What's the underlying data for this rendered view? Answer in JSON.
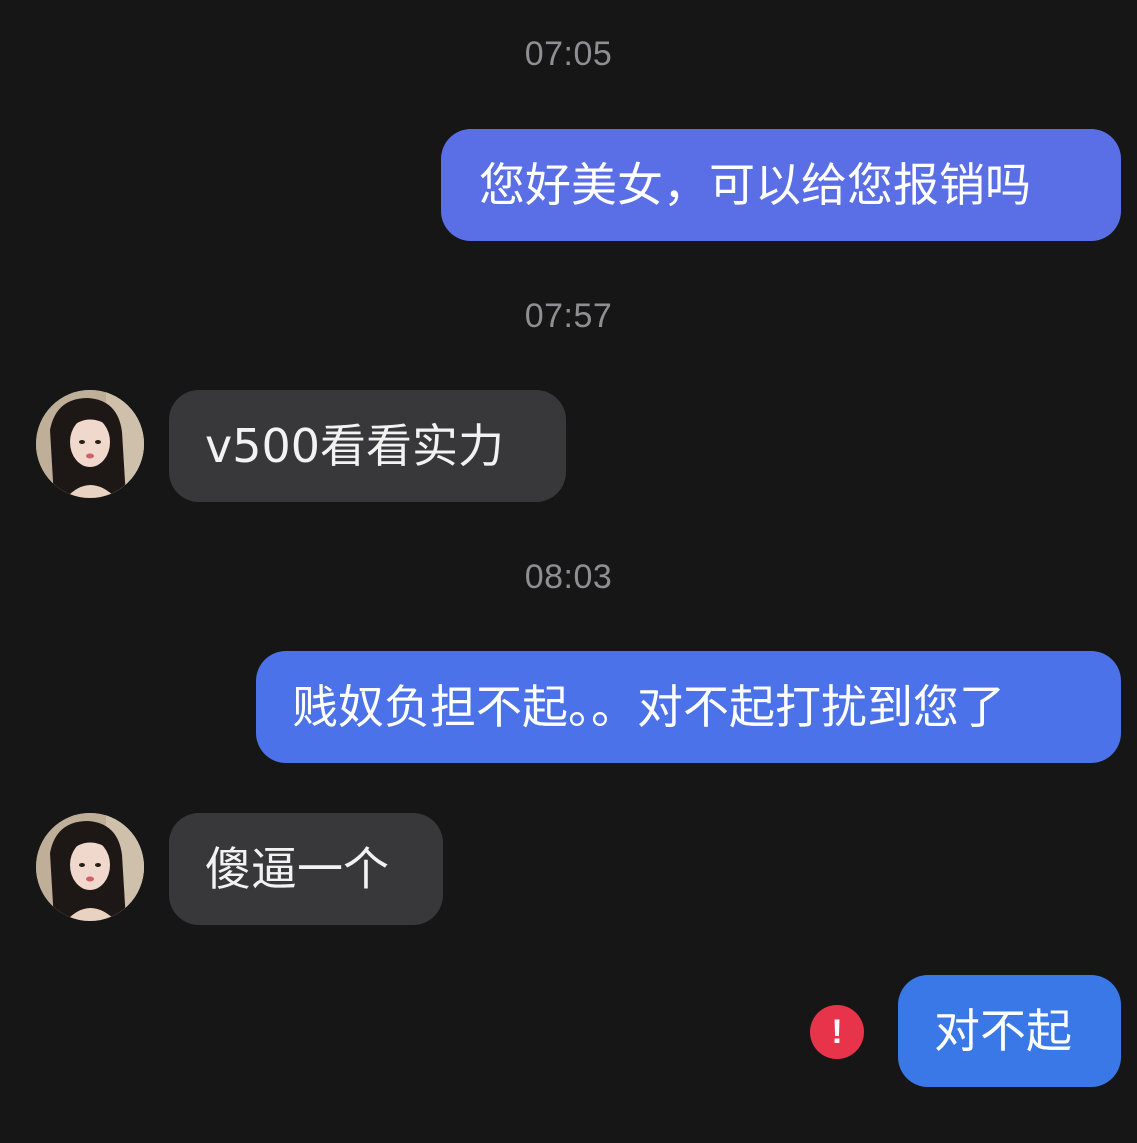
{
  "colors": {
    "background": "#161617",
    "outgoing_bubble": "#4f72e6",
    "incoming_bubble": "#38383b",
    "timestamp_text": "#8e8e93",
    "error_badge": "#e8344a"
  },
  "messages": [
    {
      "type": "timestamp",
      "text": "07:05"
    },
    {
      "type": "outgoing",
      "text": "您好美女，可以给您报销吗",
      "color": "#5a6fe6"
    },
    {
      "type": "timestamp",
      "text": "07:57"
    },
    {
      "type": "incoming",
      "text": "v500看看实力",
      "avatar": "avatar-icon"
    },
    {
      "type": "timestamp",
      "text": "08:03"
    },
    {
      "type": "outgoing",
      "text": "贱奴负担不起。。对不起打扰到您了",
      "color": "#4b72e8"
    },
    {
      "type": "incoming",
      "text": "傻逼一个",
      "avatar": "avatar-icon"
    },
    {
      "type": "outgoing",
      "text": "对不起",
      "color": "#3a78e8",
      "status": "failed"
    }
  ],
  "error_badge": {
    "symbol": "!",
    "icon": "exclamation-icon"
  }
}
